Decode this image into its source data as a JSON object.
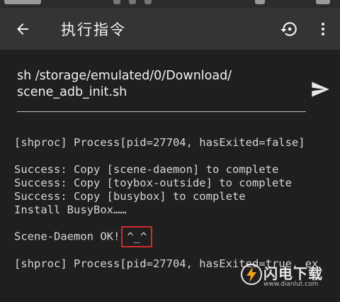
{
  "appbar": {
    "title": "执行指令"
  },
  "command": {
    "text": "sh /storage/emulated/0/Download/\nscene_adb_init.sh"
  },
  "console": {
    "lines": [
      "[shproc] Process[pid=27704, hasExited=false]",
      "Success: Copy [scene-daemon] to complete",
      "Success: Copy [toybox-outside] to complete",
      "Success: Copy [busybox] to complete",
      "Install BusyBox……",
      "Scene-Daemon OK!",
      "^_^",
      "[shproc] Process[pid=27704, hasExited=true, ex"
    ]
  },
  "watermark": {
    "brand": "闪电下载",
    "url": "www.dianlut.com"
  },
  "colors": {
    "appbar": "#343434",
    "console_bg": "#1f1f1f",
    "highlight_border": "#d42a2a",
    "watermark_bolt": "#f0a020"
  },
  "icons": {
    "back": "arrow-left-icon",
    "history": "history-icon",
    "menu": "more-vert-icon",
    "send": "send-icon",
    "watermark_logo": "lightning-bolt-icon"
  }
}
